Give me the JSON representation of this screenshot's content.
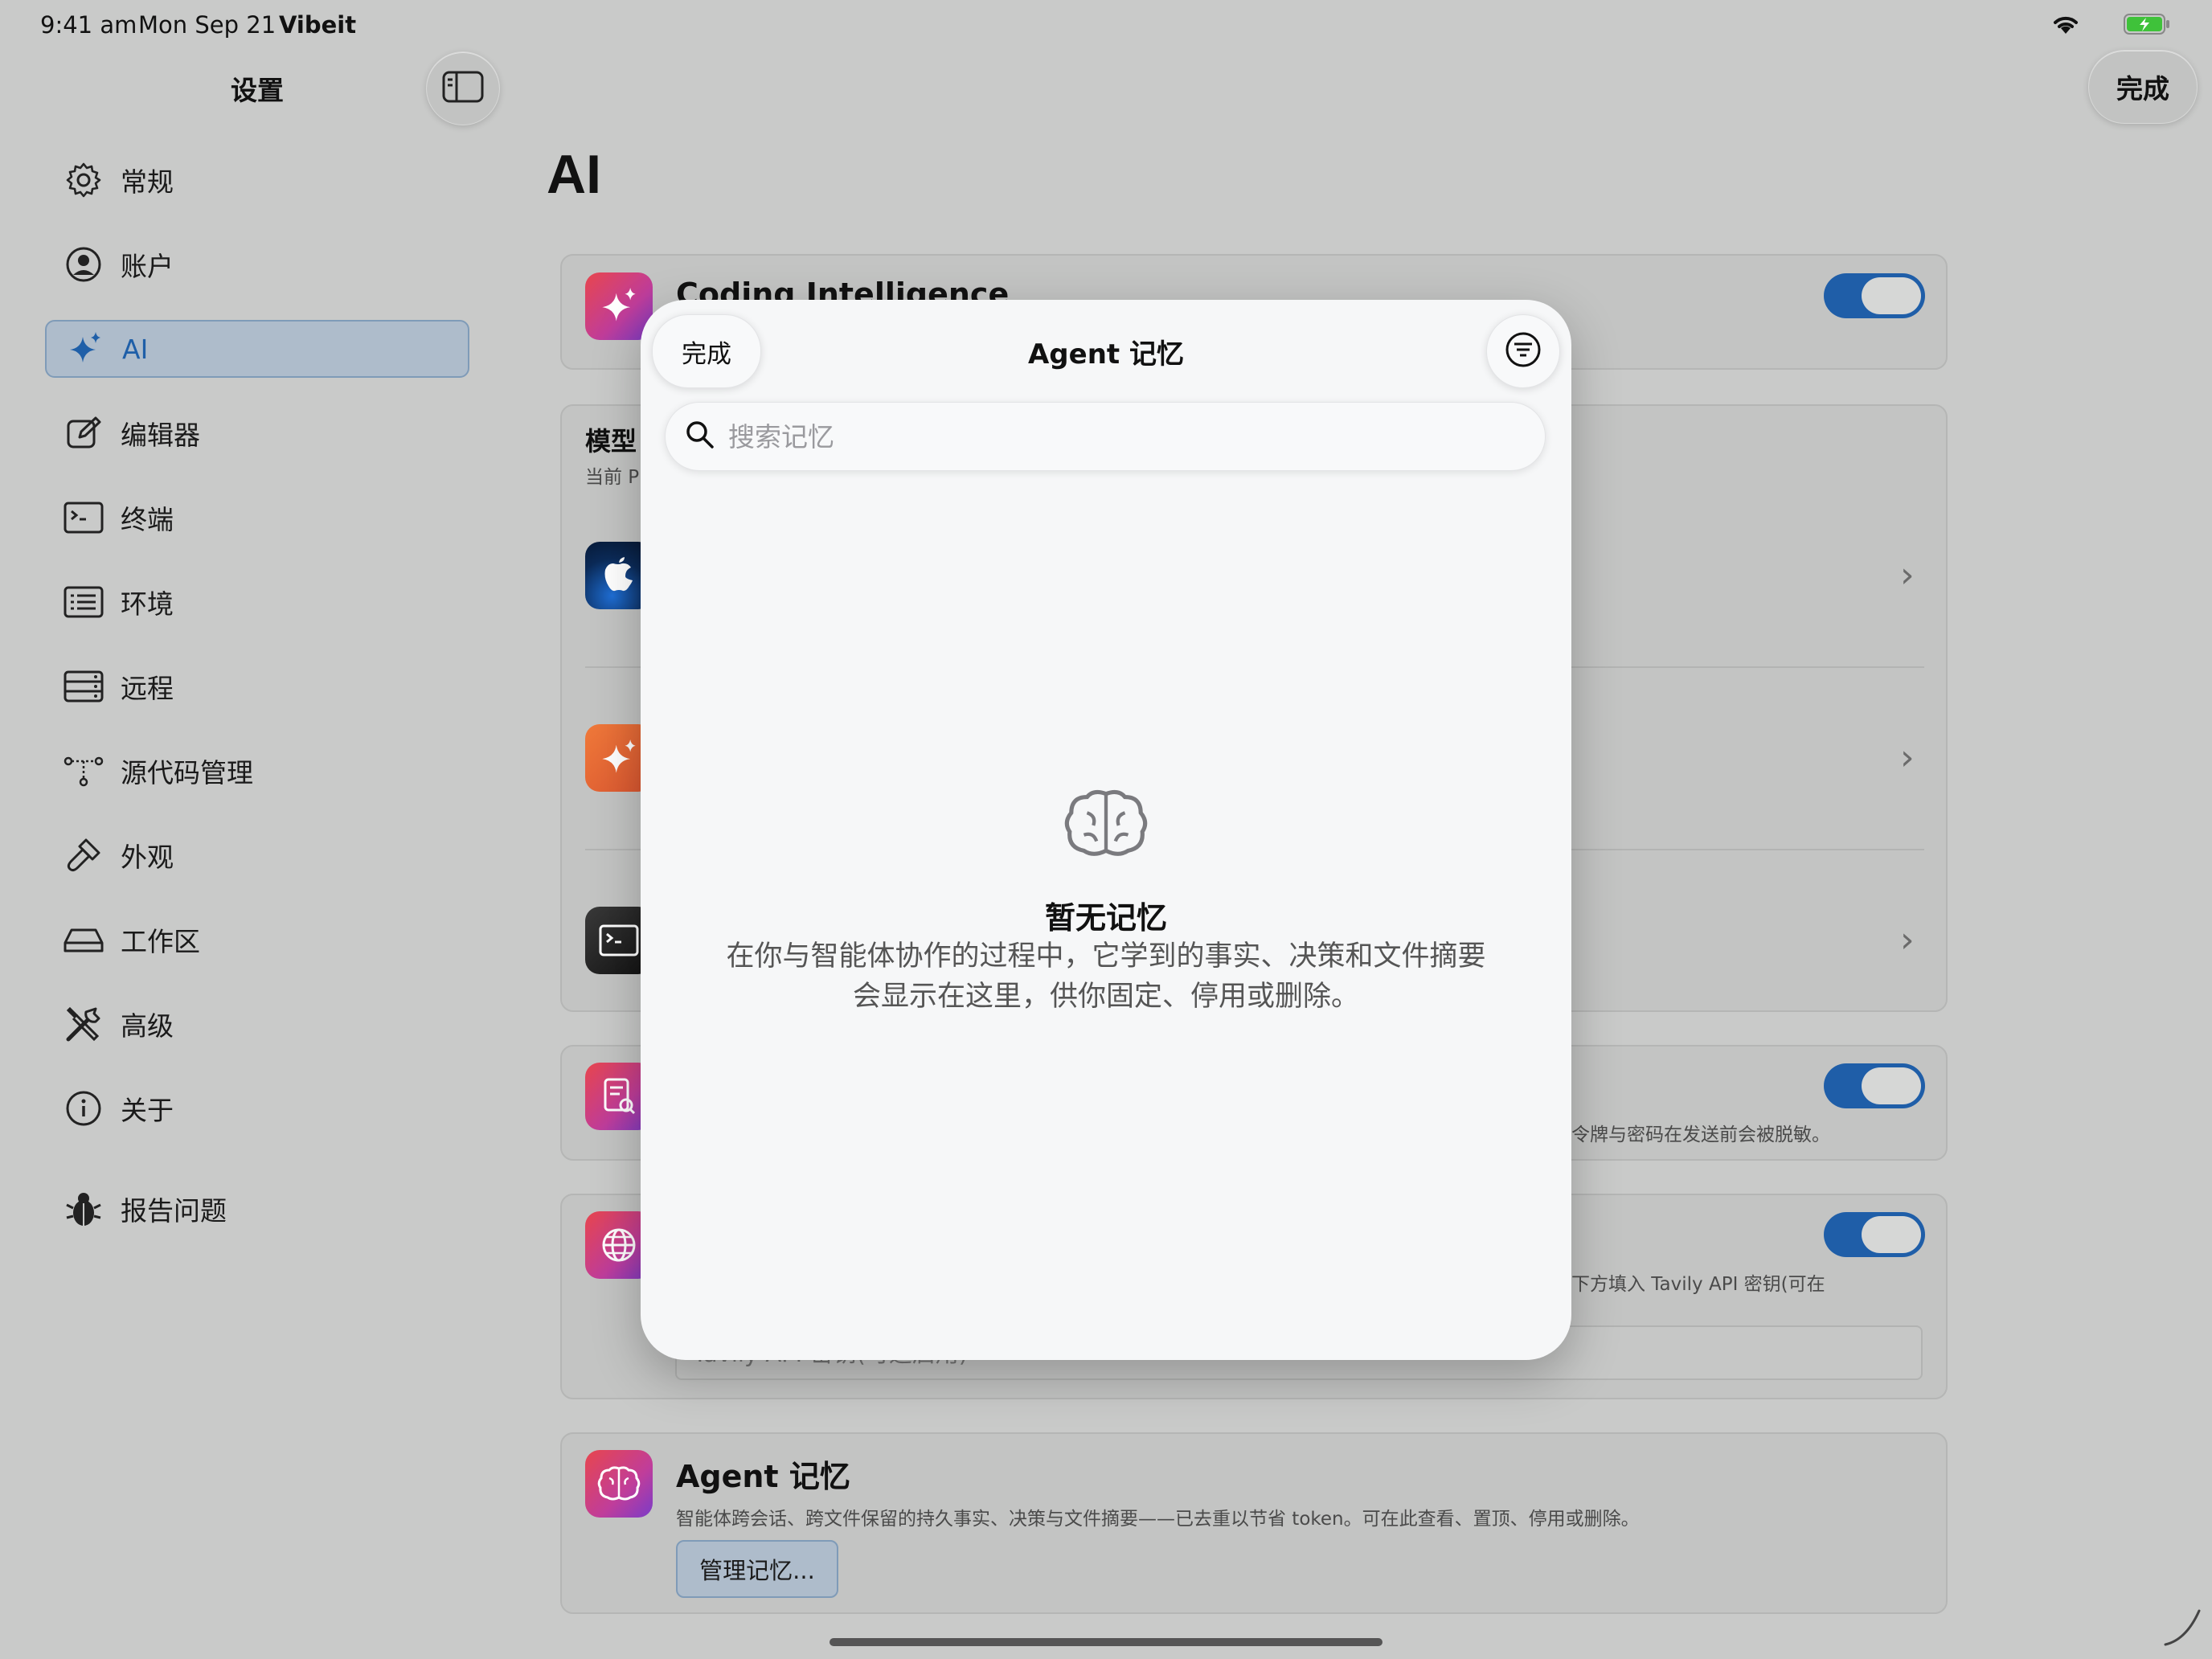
{
  "status_bar": {
    "time": "9:41 am",
    "date": "Mon Sep 21",
    "app": "Vibeit"
  },
  "sidebar": {
    "title": "设置",
    "items": [
      {
        "label": "常规",
        "icon": "gear-icon"
      },
      {
        "label": "账户",
        "icon": "person-circle-icon"
      },
      {
        "label": "AI",
        "icon": "sparkles-icon"
      },
      {
        "label": "编辑器",
        "icon": "square-pencil-icon"
      },
      {
        "label": "终端",
        "icon": "terminal-icon"
      },
      {
        "label": "环境",
        "icon": "list-icon"
      },
      {
        "label": "远程",
        "icon": "server-icon"
      },
      {
        "label": "源代码管理",
        "icon": "branch-icon"
      },
      {
        "label": "外观",
        "icon": "paintbrush-icon"
      },
      {
        "label": "工作区",
        "icon": "drive-icon"
      },
      {
        "label": "高级",
        "icon": "tools-icon"
      },
      {
        "label": "关于",
        "icon": "info-icon"
      }
    ],
    "report": {
      "label": "报告问题",
      "icon": "bug-icon"
    },
    "selected": "AI"
  },
  "header": {
    "done_label": "完成"
  },
  "main": {
    "title": "AI",
    "coding_intelligence": {
      "title": "Coding Intelligence",
      "enabled": true
    },
    "model": {
      "title": "模型",
      "subtitle_prefix": "当前 P"
    },
    "privacy_text": "令牌与密码在发送前会被脱敏。",
    "web_search_text": "下方填入 Tavily API 密钥(可在",
    "tavily_placeholder": "Tavily API 密钥(可选启用)",
    "agent_memory": {
      "title": "Agent 记忆",
      "description": "智能体跨会话、跨文件保留的持久事实、决策与文件摘要——已去重以节省 token。可在此查看、置顶、停用或删除。",
      "manage_label": "管理记忆..."
    }
  },
  "modal": {
    "title": "Agent 记忆",
    "done_label": "完成",
    "search_placeholder": "搜索记忆",
    "empty_title": "暂无记忆",
    "empty_description": "在你与智能体协作的过程中，它学到的事实、决策和文件摘要会显示在这里，供你固定、停用或删除。"
  },
  "colors": {
    "accent": "#1f5ea8",
    "background": "#c9cac9",
    "modal": "#f6f7f8"
  }
}
